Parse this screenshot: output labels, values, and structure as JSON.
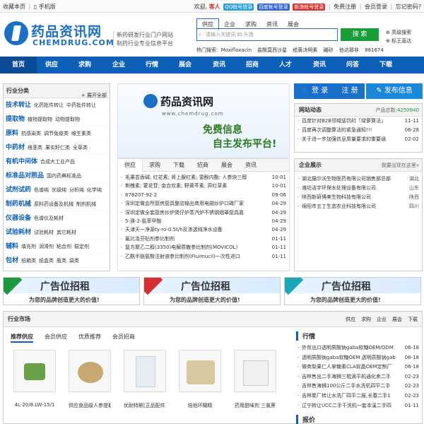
{
  "topbar": {
    "left": [
      "收藏本页",
      "手机版"
    ],
    "welcome": "欢迎,",
    "guest": "客人",
    "badges": [
      {
        "label": "QQ帐号登录",
        "color": "#2a9fe0"
      },
      {
        "label": "百度帐号登录",
        "color": "#2f64d8"
      },
      {
        "label": "新浪帐号登录",
        "color": "#d8322e"
      }
    ],
    "links": [
      "免费注册",
      "会员登录",
      "忘记密码?"
    ]
  },
  "logo": {
    "cn": "药品资讯网",
    "en": "CHEMDRUG.COM"
  },
  "slogan": [
    "新药研发行业门户网站",
    "制药行业专业信息平台"
  ],
  "search": {
    "tabs": [
      "供应",
      "企业",
      "求购",
      "资讯",
      "展会"
    ],
    "placeholder": "请输入关键词,如:头孢",
    "button": "搜 索",
    "side": [
      "高级搜索",
      "标王直达"
    ],
    "hot_label": "热门搜索:",
    "hot": [
      "Moxifloxacin",
      "盐酸莫西沙星",
      "榄黄决明素",
      "硼砂",
      "他达那非",
      "881674"
    ]
  },
  "nav": [
    "首页",
    "供应",
    "求购",
    "企业",
    "行情",
    "展会",
    "资讯",
    "招商",
    "人才",
    "资讯",
    "问答",
    "下载"
  ],
  "category": {
    "title": "行业分类",
    "expand": "展开全部",
    "rows": [
      {
        "name": "技术转让",
        "subs": [
          "化药批件转让",
          "中药批件转让"
        ]
      },
      {
        "name": "提取物",
        "subs": [
          "植物提取物",
          "动物提取物"
        ]
      },
      {
        "name": "原料",
        "subs": [
          "抗感染类",
          "调节免疫类",
          "维生素类"
        ]
      },
      {
        "name": "中药材",
        "subs": [
          "根茎类",
          "果实籽仁类",
          "全草类"
        ]
      },
      {
        "name": "有机中间体",
        "subs": [
          "合成大工业产品"
        ]
      },
      {
        "name": "标准品对照品",
        "subs": [
          "国内药典标准品"
        ]
      },
      {
        "name": "试剂试药",
        "subs": [
          "色谱纯",
          "优级纯",
          "分析纯",
          "化学纯"
        ]
      },
      {
        "name": "制药机械",
        "subs": [
          "原料药设备及机械",
          "制剂机械"
        ]
      },
      {
        "name": "仪器设备",
        "subs": [
          "色谱仪及耗材"
        ]
      },
      {
        "name": "试验耗材",
        "subs": [
          "试验耗材",
          "其它耗材"
        ]
      },
      {
        "name": "辅料",
        "subs": [
          "填充剂",
          "润滑剂",
          "粘合剂",
          "稳定剂"
        ]
      },
      {
        "name": "包材",
        "subs": [
          "纸箱类",
          "纸盒类",
          "瓶类",
          "袋类"
        ]
      }
    ]
  },
  "banner": {
    "title": "药品资讯网",
    "url": "www.chemdrug.com",
    "line1": "免费信息",
    "line2": "自主发布平台!"
  },
  "news": {
    "tabs": [
      "供应",
      "求购",
      "下载",
      "招商",
      "展会",
      "资讯"
    ],
    "items": [
      {
        "t": "毛果芸香碱; 红花素; 肾上腺红素; 雷酚内酯; 人参炔三醇",
        "d": "10-01"
      },
      {
        "t": "荆槐素; 蒙花苷; 金合欢素; 野黄芩素; 异红草素",
        "d": "10-01"
      },
      {
        "t": "878207-92-2",
        "d": "09-06"
      },
      {
        "t": "深圳定做会所厨房厨具整店输出商用电磁炒炉口碑厂家",
        "d": "04-29"
      },
      {
        "t": "深圳定做全套厨房炒炉煲仔炉蒸汽炉不锈钢烟罩厨具嘉",
        "d": "04-29"
      },
      {
        "t": "5-溴-2-氨苯甲酸",
        "d": "04-29"
      },
      {
        "t": "天津天一净源ty-ro-0.5t/h反渗透纯净水设备",
        "d": "04-29"
      },
      {
        "t": "氟比洛芬贴剂参比制剂",
        "d": "01-11"
      },
      {
        "t": "复方聚乙二醇(3350)电解质散参比制剂(MOVICOL)",
        "d": "01-11"
      },
      {
        "t": "乙酰半胱氨酸注射液参比制剂(Fluimucil)一次性进口",
        "d": "01-11"
      }
    ]
  },
  "login": {
    "login": "登 录",
    "register": "注 册",
    "publish": "发布信息"
  },
  "dynamic": {
    "title": "网站动态",
    "count_label": "产品总数:",
    "count": "4250940",
    "items": [
      {
        "t": "百度针对B2B领域惩罚的「绿萝算法」",
        "d": "11-11"
      },
      {
        "t": "百度再次调整算法的紧急通知!!!",
        "d": "06-28"
      },
      {
        "t": "关于进一步加强信息质量要求的重要通",
        "d": "02-02"
      }
    ]
  },
  "companies": {
    "title": "企业展示",
    "more": "我要出现在这里»",
    "items": [
      {
        "t": "湖北猫尔沃生物医药有限公司销售部总部",
        "d": "湖北"
      },
      {
        "t": "潍坊洁宇环保水处理设备有限公司",
        "d": "山东"
      },
      {
        "t": "陕西新研博美生物科技有限公司",
        "d": "陕西"
      },
      {
        "t": "绵阳市五丁生态农业科技有限公司",
        "d": "四川"
      }
    ]
  },
  "ads": [
    {
      "title": "广告位招租",
      "sub": "为您的品牌创造更大的价值!",
      "color": "#1a9a3a"
    },
    {
      "title": "广告位招租",
      "sub": "为您的品牌创造更大的价值!",
      "color": "#d62e2e"
    },
    {
      "title": "广告位招租",
      "sub": "为您的品牌创造更大的价值!",
      "color": "#1aa8b8"
    }
  ],
  "market": {
    "title": "行业市场",
    "links": [
      "供应",
      "求购",
      "企业",
      "展会",
      "下载"
    ],
    "tabs": [
      "推荐供应",
      "会员供应",
      "优质推荐",
      "会员招商"
    ],
    "products": [
      {
        "cap": "4L-20/8.LW-15/1",
        "color": "#6aa04a"
      },
      {
        "cap": "供应食品级人参提取",
        "color": "#c8a870"
      },
      {
        "cap": "优耐特斯[正品配件]",
        "color": "#e6ecf2"
      },
      {
        "cap": "倍他环糊精",
        "color": "#d8c8a0"
      },
      {
        "cap": "药用甜味剂 三氯蔗",
        "color": "#f0f0f0"
      }
    ],
    "hangqing_title": "行情",
    "hangqing": [
      {
        "t": "外贸出口透明质酸钠gaba软糖OEM/ODM",
        "d": "06-18"
      },
      {
        "t": "透明质酸钠gaba软糖OEM 透明质酸钠gab",
        "d": "06-18"
      },
      {
        "t": "微商梨果仁人掌糖素CLA软晶OEM定制厂",
        "d": "06-18"
      },
      {
        "t": "吉林售出二手海狮三辊滴平机通化卖二手",
        "d": "02-23"
      },
      {
        "t": "吉林售海狮100公斤二手水洗机四平二手",
        "d": "02-23"
      },
      {
        "t": "吉林聚厂转让水洗厂四平二报,长春二手1",
        "d": "02-23"
      },
      {
        "t": "辽宁转让UCC二手干洗机一套本溪二手四",
        "d": "01-11"
      }
    ],
    "baojia": "报价"
  }
}
